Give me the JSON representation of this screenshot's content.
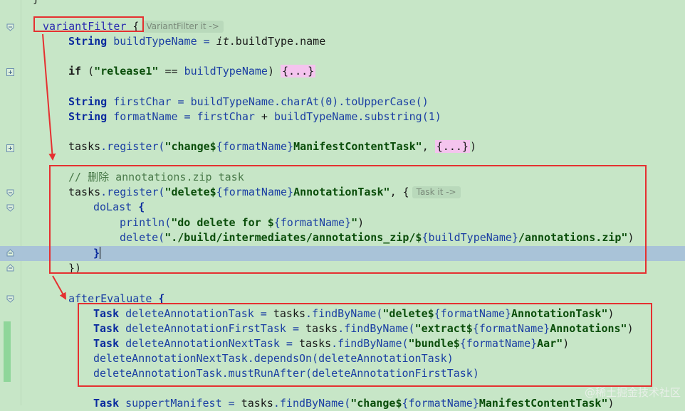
{
  "editor": {
    "lines": {
      "top_brace": "}",
      "l1_name": "variantFilter",
      "l1_brace": " {",
      "l1_hint": "VariantFilter it ->",
      "l2_type": "String",
      "l2_rest": " buildTypeName = ",
      "l2_it": "it",
      "l2_tail": ".buildType.name",
      "l3_if": "if",
      "l3_open": " (",
      "l3_str": "\"release1\"",
      "l3_eq": " == ",
      "l3_var": "buildTypeName",
      "l3_close": ") ",
      "l3_fold": "{...}",
      "l4_type": "String",
      "l4_rest": " firstChar = ",
      "l4_var": "buildTypeName",
      "l4_call": ".charAt(0).toUpperCase()",
      "l5_type": "String",
      "l5_rest": " formatName = ",
      "l5_a": "firstChar",
      "l5_plus": " + ",
      "l5_b": "buildTypeName",
      "l5_call": ".substring(1)",
      "l6_obj": "tasks",
      "l6_m": ".register(",
      "l6_s1": "\"change$",
      "l6_p": "{formatName}",
      "l6_s2": "ManifestContentTask\"",
      "l6_sep": ", ",
      "l6_fold": "{...}",
      "l6_end": ")",
      "l7_comment": "// 删除 annotations.zip task",
      "l8_obj": "tasks",
      "l8_m": ".register(",
      "l8_s1": "\"delete$",
      "l8_p": "{formatName}",
      "l8_s2": "AnnotationTask\"",
      "l8_end": ", {",
      "l8_hint": "Task it ->",
      "l9_kw": "doLast",
      "l9_brace": " {",
      "l10_fn": "println(",
      "l10_s1": "\"do delete for $",
      "l10_p": "{formatName}",
      "l10_s2": "\"",
      "l10_end": ")",
      "l11_fn": "delete(",
      "l11_s1": "\"./build/intermediates/annotations_zip/$",
      "l11_p": "{buildTypeName}",
      "l11_s2": "/annotations.zip\"",
      "l11_end": ")",
      "l12_brace": "}",
      "l13_brace": "})",
      "l14_kw": "afterEvaluate",
      "l14_brace": " {",
      "l15_type": "Task",
      "l15_var": " deleteAnnotationTask = ",
      "l15_obj": "tasks",
      "l15_m": ".findByName(",
      "l15_s1": "\"delete$",
      "l15_p": "{formatName}",
      "l15_s2": "AnnotationTask\"",
      "l15_end": ")",
      "l16_type": "Task",
      "l16_var": " deleteAnnotationFirstTask = ",
      "l16_obj": "tasks",
      "l16_m": ".findByName(",
      "l16_s1": "\"extract$",
      "l16_p": "{formatName}",
      "l16_s2": "Annotations\"",
      "l16_end": ")",
      "l17_type": "Task",
      "l17_var": " deleteAnnotationNextTask = ",
      "l17_obj": "tasks",
      "l17_m": ".findByName(",
      "l17_s1": "\"bundle$",
      "l17_p": "{formatName}",
      "l17_s2": "Aar\"",
      "l17_end": ")",
      "l18_a": "deleteAnnotationNextTask",
      "l18_m": ".dependsOn(",
      "l18_b": "deleteAnnotationTask",
      "l18_end": ")",
      "l19_a": "deleteAnnotationTask",
      "l19_m": ".mustRunAfter(",
      "l19_b": "deleteAnnotationFirstTask",
      "l19_end": ")",
      "l20_type": "Task",
      "l20_var": " suppertManifest = ",
      "l20_obj": "tasks",
      "l20_m": ".findByName(",
      "l20_s1": "\"change$",
      "l20_p": "{formatName}",
      "l20_s2": "ManifestContentTask\"",
      "l20_end": ")"
    }
  },
  "watermark": "@稀土掘金技术社区",
  "colors": {
    "editor_background": "#c7e6c7",
    "current_line": "#a9c3d8",
    "annotation_red": "#e53030"
  }
}
